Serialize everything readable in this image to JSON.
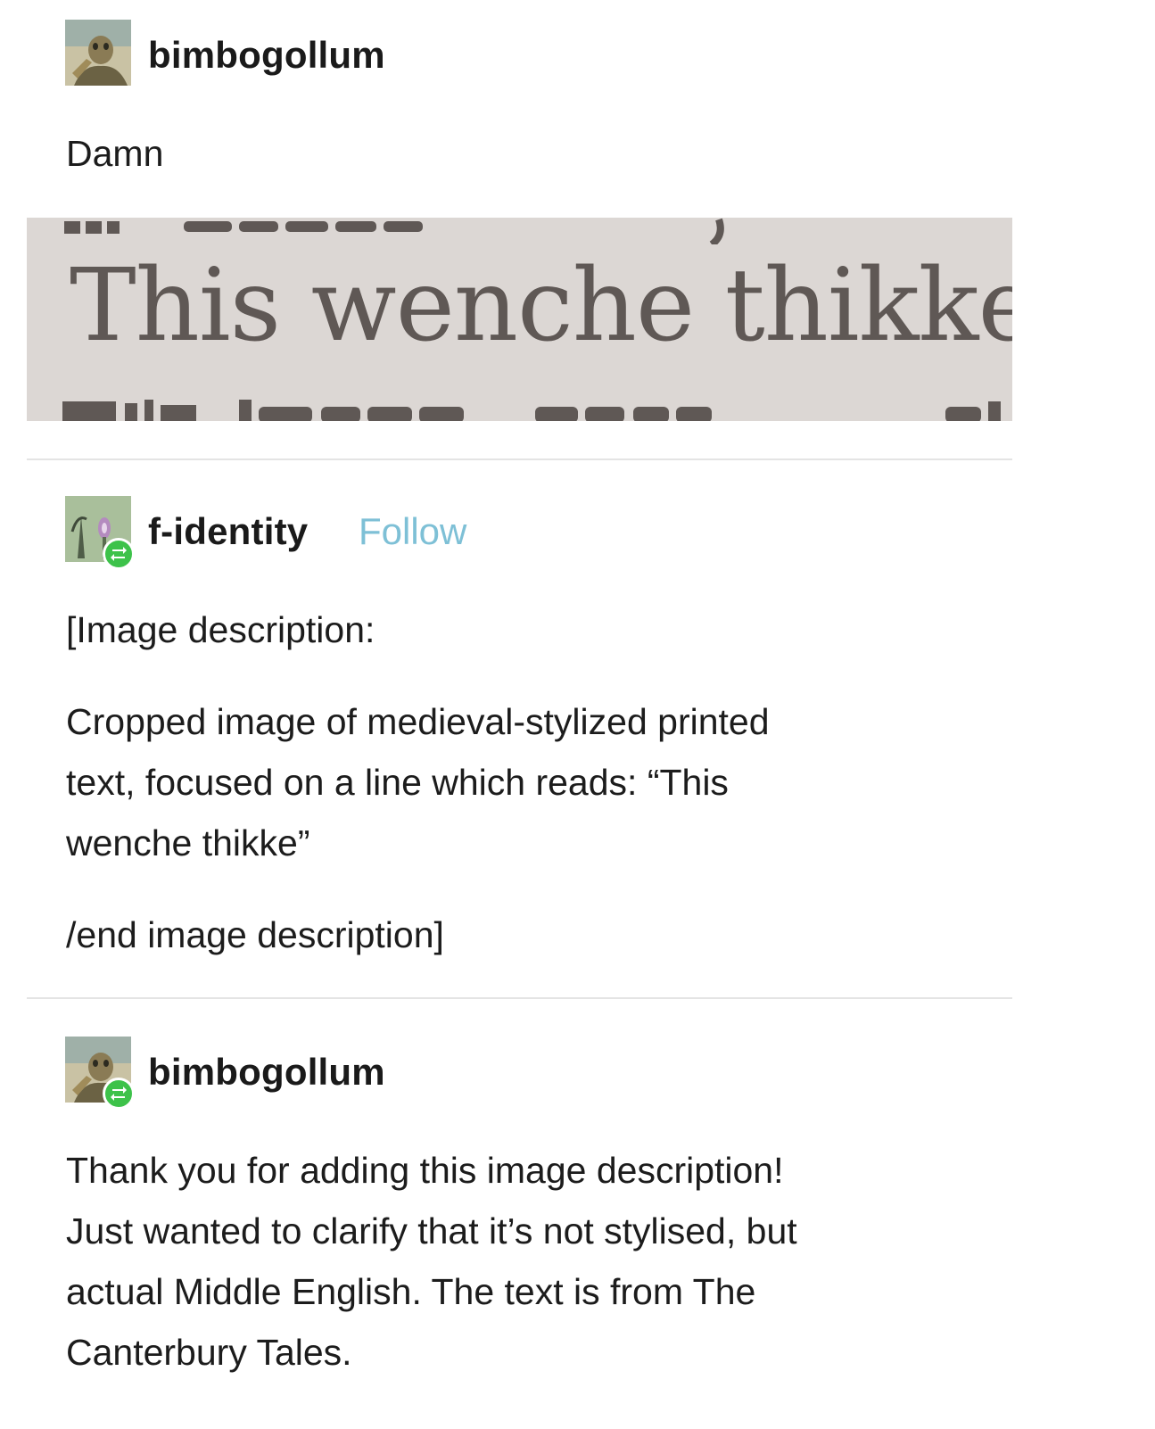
{
  "posts": [
    {
      "username": "bimbogollum",
      "avatar_icon": "gollum-avatar-icon",
      "body": [
        "Damn"
      ],
      "image_text": "This wenche thikke"
    },
    {
      "username": "f-identity",
      "avatar_icon": "flower-avatar-icon",
      "reblog_icon": "reblog-icon",
      "follow_label": "Follow",
      "body": [
        "[Image description:",
        "Cropped image of medieval-stylized printed",
        "text, focused on a line which reads: “This",
        "wenche thikke”",
        "/end image description]"
      ]
    },
    {
      "username": "bimbogollum",
      "avatar_icon": "gollum-avatar-icon",
      "reblog_icon": "reblog-icon",
      "body": [
        "Thank you for adding this image description!",
        "Just wanted to clarify that it’s not stylised, but",
        "actual Middle English. The text is from The",
        "Canterbury Tales."
      ]
    }
  ],
  "colors": {
    "follow": "#7ec0d6",
    "reblog_badge": "#3dc24a",
    "divider": "#e4e4e4",
    "scan_paper": "#dcd7d4",
    "scan_ink": "#5f5855"
  }
}
